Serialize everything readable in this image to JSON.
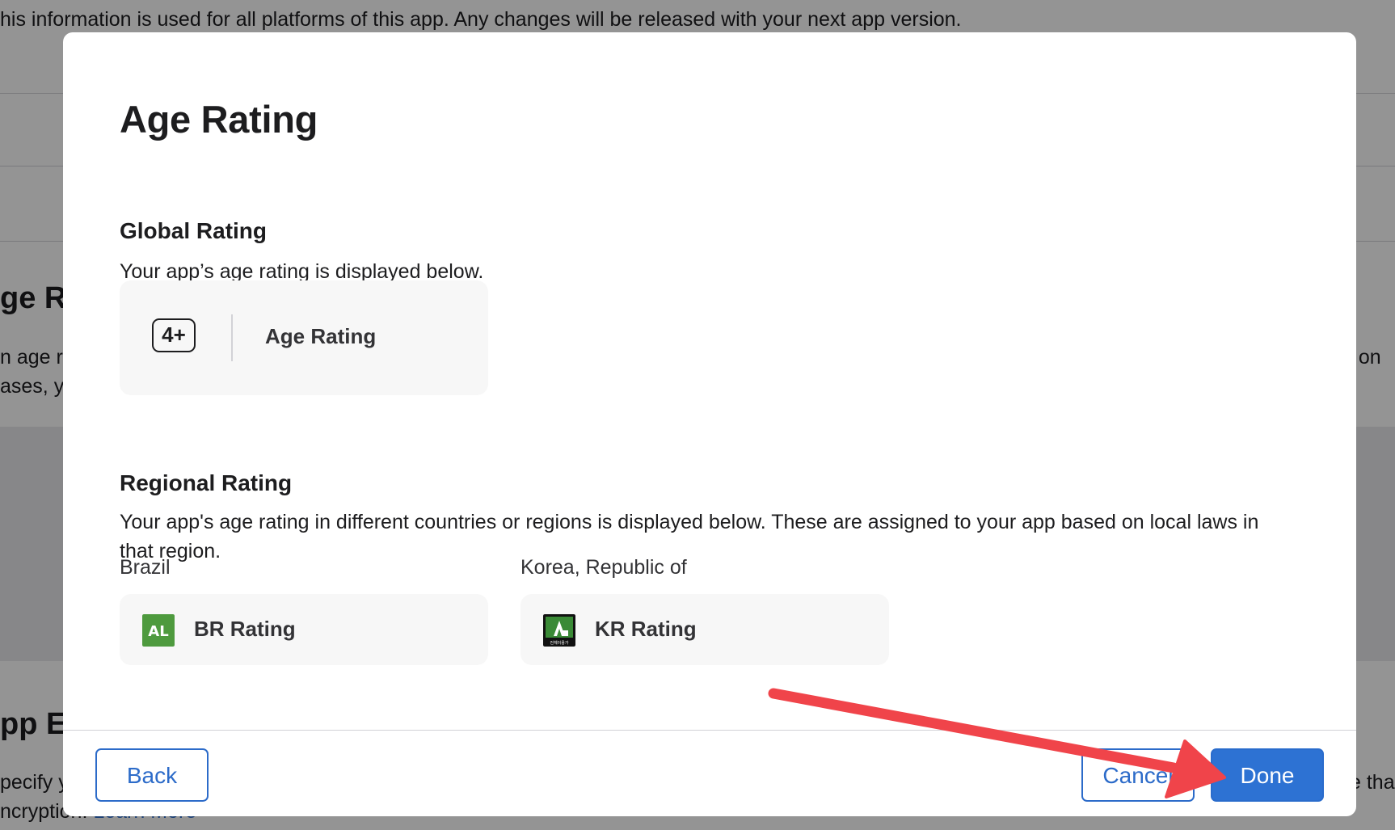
{
  "background": {
    "info_text": "his information is used for all platforms of this app. Any changes will be released with your next app version.",
    "section1_heading_fragment": "ge R",
    "section1_left_line1": "n age r",
    "section1_left_line2": "ases, y",
    "section1_right_fragment": "d on",
    "section2_heading_fragment": "pp E",
    "section2_left_line1": "pecify y",
    "section2_left_line2": "ncryption.",
    "section2_link_fragment": "Learn More",
    "section2_right_fragment": "e tha"
  },
  "modal": {
    "title": "Age Rating",
    "global": {
      "heading": "Global Rating",
      "description": "Your app’s age rating is displayed below.",
      "badge_text": "4+",
      "rating_label": "Age Rating"
    },
    "regional": {
      "heading": "Regional Rating",
      "description": "Your app's age rating in different countries or regions is displayed below. These are assigned to your app based on local laws in that region.",
      "items": [
        {
          "country": "Brazil",
          "label": "BR Rating",
          "icon": "brazil-al-rating-icon",
          "icon_text": "AL",
          "icon_color": "#4e9a3e"
        },
        {
          "country": "Korea, Republic of",
          "label": "KR Rating",
          "icon": "korea-all-ages-rating-icon",
          "icon_text": "전체이용가",
          "icon_color": "#3a8a36"
        }
      ]
    },
    "footer": {
      "back_label": "Back",
      "cancel_label": "Cancel",
      "done_label": "Done"
    }
  },
  "annotation": {
    "arrow_color": "#f0444a",
    "arrow_icon": "red-arrow-pointing-to-done"
  },
  "colors": {
    "accent": "#2d72d3",
    "card_background": "#f7f7f7",
    "text": "#1d1d1f"
  }
}
